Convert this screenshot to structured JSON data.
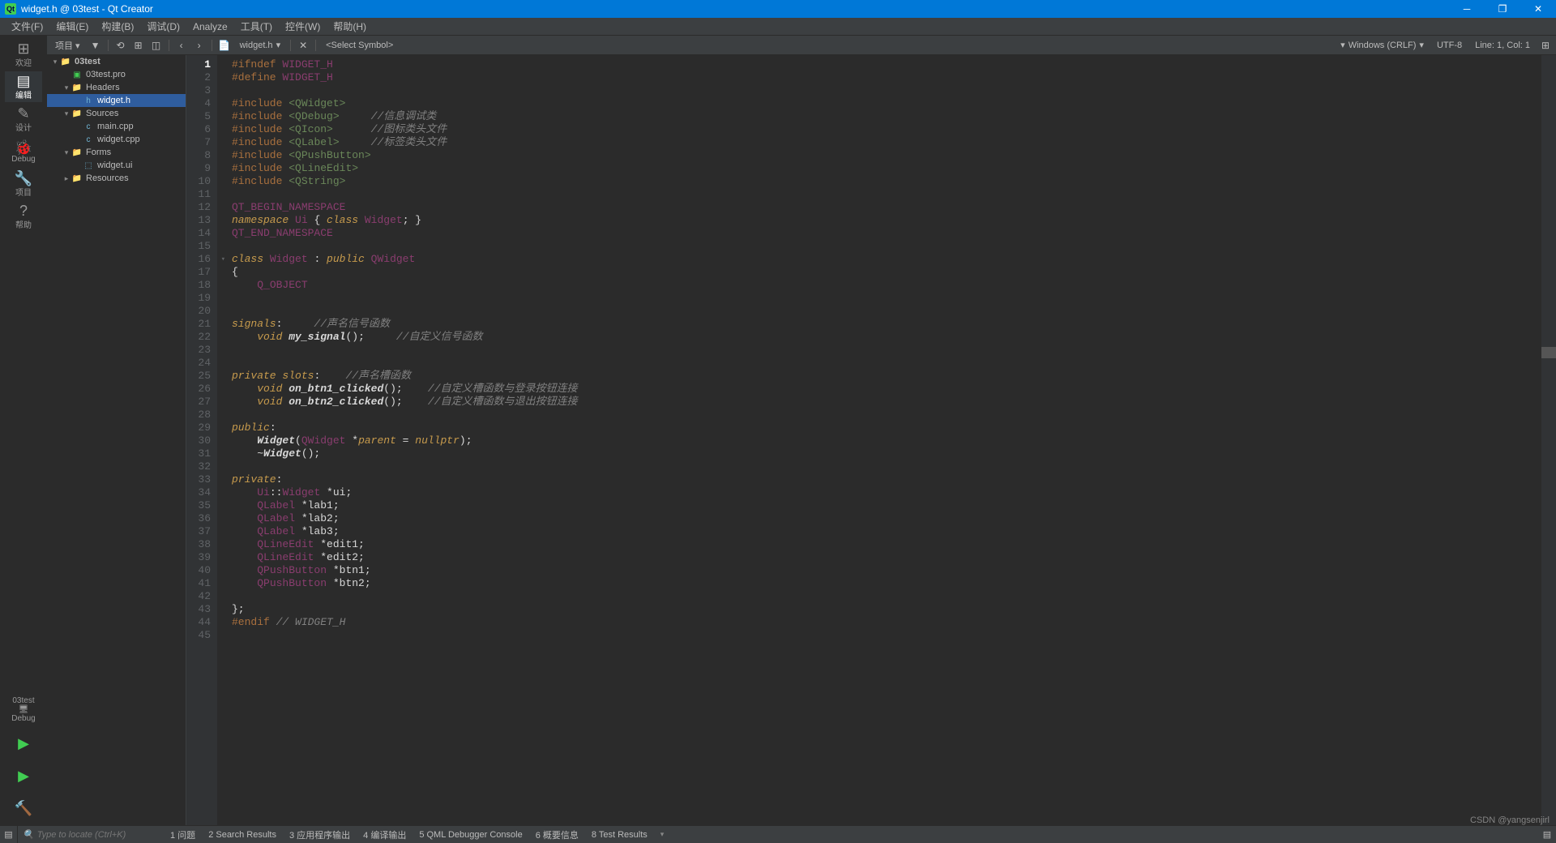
{
  "title": "widget.h @ 03test - Qt Creator",
  "menu": [
    "文件(F)",
    "编辑(E)",
    "构建(B)",
    "调试(D)",
    "Analyze",
    "工具(T)",
    "控件(W)",
    "帮助(H)"
  ],
  "toolbar": {
    "project_sel": "项目 ▾",
    "file_tab": "widget.h",
    "symbol": "<Select Symbol>",
    "encoding": "Windows (CRLF)",
    "enc2": "UTF-8",
    "pos": "Line: 1, Col: 1"
  },
  "modes": [
    {
      "label": "欢迎",
      "icon": "⊞"
    },
    {
      "label": "编辑",
      "icon": "▤",
      "active": true
    },
    {
      "label": "设计",
      "icon": "✎"
    },
    {
      "label": "Debug",
      "icon": "🐞"
    },
    {
      "label": "项目",
      "icon": "🔧"
    },
    {
      "label": "帮助",
      "icon": "?"
    }
  ],
  "kits": [
    {
      "label": "03test",
      "icon": "🖥"
    },
    {
      "label": "Debug",
      "icon": "🖥"
    }
  ],
  "run_icons": [
    "▶",
    "▶",
    "🔨"
  ],
  "tree": {
    "root": "03test",
    "pro": "03test.pro",
    "headers": "Headers",
    "header_items": [
      "widget.h"
    ],
    "sources": "Sources",
    "source_items": [
      "main.cpp",
      "widget.cpp"
    ],
    "forms": "Forms",
    "form_items": [
      "widget.ui"
    ],
    "resources": "Resources"
  },
  "code": [
    {
      "n": 1,
      "h": "<span class='pp'>#ifndef</span> <span class='mac'>WIDGET_H</span>"
    },
    {
      "n": 2,
      "h": "<span class='pp'>#define</span> <span class='mac'>WIDGET_H</span>"
    },
    {
      "n": 3,
      "h": ""
    },
    {
      "n": 4,
      "h": "<span class='pp'>#include</span> <span class='inc'>&lt;QWidget&gt;</span>"
    },
    {
      "n": 5,
      "h": "<span class='pp'>#include</span> <span class='inc'>&lt;QDebug&gt;</span>     <span class='cm'>//信息调试类</span>"
    },
    {
      "n": 6,
      "h": "<span class='pp'>#include</span> <span class='inc'>&lt;QIcon&gt;</span>      <span class='cm'>//图标类头文件</span>"
    },
    {
      "n": 7,
      "h": "<span class='pp'>#include</span> <span class='inc'>&lt;QLabel&gt;</span>     <span class='cm'>//标签类头文件</span>"
    },
    {
      "n": 8,
      "h": "<span class='pp'>#include</span> <span class='inc'>&lt;QPushButton&gt;</span>"
    },
    {
      "n": 9,
      "h": "<span class='pp'>#include</span> <span class='inc'>&lt;QLineEdit&gt;</span>"
    },
    {
      "n": 10,
      "h": "<span class='pp'>#include</span> <span class='inc'>&lt;QString&gt;</span>"
    },
    {
      "n": 11,
      "h": ""
    },
    {
      "n": 12,
      "h": "<span class='mac'>QT_BEGIN_NAMESPACE</span>"
    },
    {
      "n": 13,
      "h": "<span class='kw'>namespace</span> <span class='cls'>Ui</span> { <span class='kw'>class</span> <span class='cls'>Widget</span>; }"
    },
    {
      "n": 14,
      "h": "<span class='mac'>QT_END_NAMESPACE</span>"
    },
    {
      "n": 15,
      "h": ""
    },
    {
      "n": 16,
      "h": "<span class='kw'>class</span> <span class='cls'>Widget</span> : <span class='kw'>public</span> <span class='ty'>QWidget</span>",
      "fold": true
    },
    {
      "n": 17,
      "h": "{"
    },
    {
      "n": 18,
      "h": "    <span class='mac'>Q_OBJECT</span>"
    },
    {
      "n": 19,
      "h": ""
    },
    {
      "n": 20,
      "h": ""
    },
    {
      "n": 21,
      "h": "<span class='kw'>signals</span>:     <span class='cm'>//声名信号函数</span>"
    },
    {
      "n": 22,
      "h": "    <span class='kw'>void</span> <span class='fn'>my_signal</span>();     <span class='cm'>//自定义信号函数</span>"
    },
    {
      "n": 23,
      "h": ""
    },
    {
      "n": 24,
      "h": ""
    },
    {
      "n": 25,
      "h": "<span class='kw'>private</span> <span class='kw'>slots</span>:    <span class='cm'>//声名槽函数</span>"
    },
    {
      "n": 26,
      "h": "    <span class='kw'>void</span> <span class='fn'>on_btn1_clicked</span>();    <span class='cm'>//自定义槽函数与登录按钮连接</span>"
    },
    {
      "n": 27,
      "h": "    <span class='kw'>void</span> <span class='fn'>on_btn2_clicked</span>();    <span class='cm'>//自定义槽函数与退出按钮连接</span>"
    },
    {
      "n": 28,
      "h": ""
    },
    {
      "n": 29,
      "h": "<span class='kw'>public</span>:"
    },
    {
      "n": 30,
      "h": "    <span class='fn'>Widget</span>(<span class='ty'>QWidget</span> *<span class='kw'>parent</span> = <span class='kw'>nullptr</span>);"
    },
    {
      "n": 31,
      "h": "    ~<span class='fn'>Widget</span>();"
    },
    {
      "n": 32,
      "h": ""
    },
    {
      "n": 33,
      "h": "<span class='kw'>private</span>:"
    },
    {
      "n": 34,
      "h": "    <span class='ty'>Ui</span>::<span class='ty'>Widget</span> *ui;"
    },
    {
      "n": 35,
      "h": "    <span class='ty'>QLabel</span> *lab1;"
    },
    {
      "n": 36,
      "h": "    <span class='ty'>QLabel</span> *lab2;"
    },
    {
      "n": 37,
      "h": "    <span class='ty'>QLabel</span> *lab3;"
    },
    {
      "n": 38,
      "h": "    <span class='ty'>QLineEdit</span> *edit1;"
    },
    {
      "n": 39,
      "h": "    <span class='ty'>QLineEdit</span> *edit2;"
    },
    {
      "n": 40,
      "h": "    <span class='ty'>QPushButton</span> *btn1;"
    },
    {
      "n": 41,
      "h": "    <span class='ty'>QPushButton</span> *btn2;"
    },
    {
      "n": 42,
      "h": ""
    },
    {
      "n": 43,
      "h": "};"
    },
    {
      "n": 44,
      "h": "<span class='pp'>#endif</span> <span class='cm'>// WIDGET_H</span>"
    },
    {
      "n": 45,
      "h": ""
    }
  ],
  "status": {
    "locate_placeholder": "Type to locate (Ctrl+K)",
    "panes": [
      "1 问题",
      "2 Search Results",
      "3 应用程序输出",
      "4 编译输出",
      "5 QML Debugger Console",
      "6 概要信息",
      "8 Test Results"
    ]
  },
  "watermark": "CSDN @yangsenjirl"
}
